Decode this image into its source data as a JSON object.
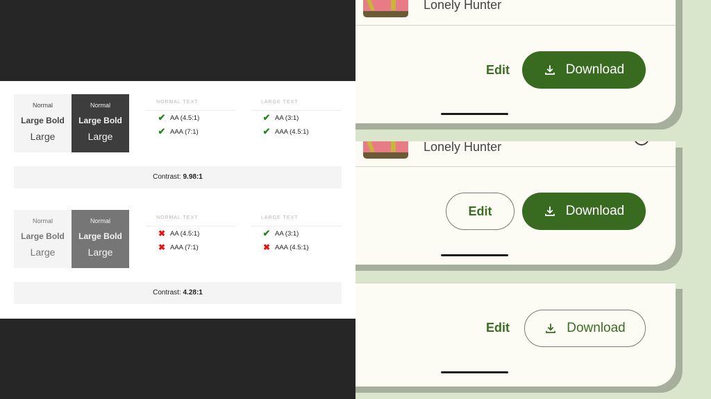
{
  "contrast_examples": [
    {
      "swatch_light": {
        "normal": "Normal",
        "large_bold": "Large Bold",
        "large": "Large",
        "bg": "#f4f4f4",
        "fg": "#444444"
      },
      "swatch_dark": {
        "normal": "Normal",
        "large_bold": "Large Bold",
        "large": "Large",
        "bg": "#3d3d3d",
        "fg": "#f4f4f4"
      },
      "normal_text": {
        "heading": "NORMAL TEXT",
        "rules": [
          {
            "label": "AA (4.5:1)",
            "status": "pass"
          },
          {
            "label": "AAA (7:1)",
            "status": "pass"
          }
        ]
      },
      "large_text": {
        "heading": "LARGE TEXT",
        "rules": [
          {
            "label": "AA (3:1)",
            "status": "pass"
          },
          {
            "label": "AAA (4.5:1)",
            "status": "pass"
          }
        ]
      },
      "contrast_label": "Contrast:",
      "contrast_value": "9.98:1"
    },
    {
      "swatch_light": {
        "normal": "Normal",
        "large_bold": "Large Bold",
        "large": "Large",
        "bg": "#f4f4f4",
        "fg": "#767676"
      },
      "swatch_dark": {
        "normal": "Normal",
        "large_bold": "Large Bold",
        "large": "Large",
        "bg": "#767676",
        "fg": "#f4f4f4"
      },
      "normal_text": {
        "heading": "NORMAL TEXT",
        "rules": [
          {
            "label": "AA (4.5:1)",
            "status": "fail"
          },
          {
            "label": "AAA (7:1)",
            "status": "fail"
          }
        ]
      },
      "large_text": {
        "heading": "LARGE TEXT",
        "rules": [
          {
            "label": "AA (3:1)",
            "status": "pass"
          },
          {
            "label": "AAA (4.5:1)",
            "status": "fail"
          }
        ]
      },
      "contrast_label": "Contrast:",
      "contrast_value": "4.28:1"
    }
  ],
  "icons": {
    "pass": "check-icon",
    "fail": "x-icon",
    "download": "download-icon"
  },
  "glyphs": {
    "pass": "✔",
    "fail": "✖"
  },
  "phones": [
    {
      "track_title": "Lonely Hunter",
      "edit_label": "Edit",
      "edit_style": "text",
      "download_label": "Download",
      "download_style": "filled"
    },
    {
      "track_title": "Lonely Hunter",
      "edit_label": "Edit",
      "edit_style": "outlined",
      "download_label": "Download",
      "download_style": "filled"
    },
    {
      "track_title": "",
      "edit_label": "Edit",
      "edit_style": "text",
      "download_label": "Download",
      "download_style": "outlined"
    }
  ],
  "colors": {
    "primary_green": "#386a20",
    "pass_green": "#1e8a1e",
    "fail_red": "#ee1111",
    "surface": "#fcfcf5",
    "backdrop": "#d9e6cb"
  }
}
